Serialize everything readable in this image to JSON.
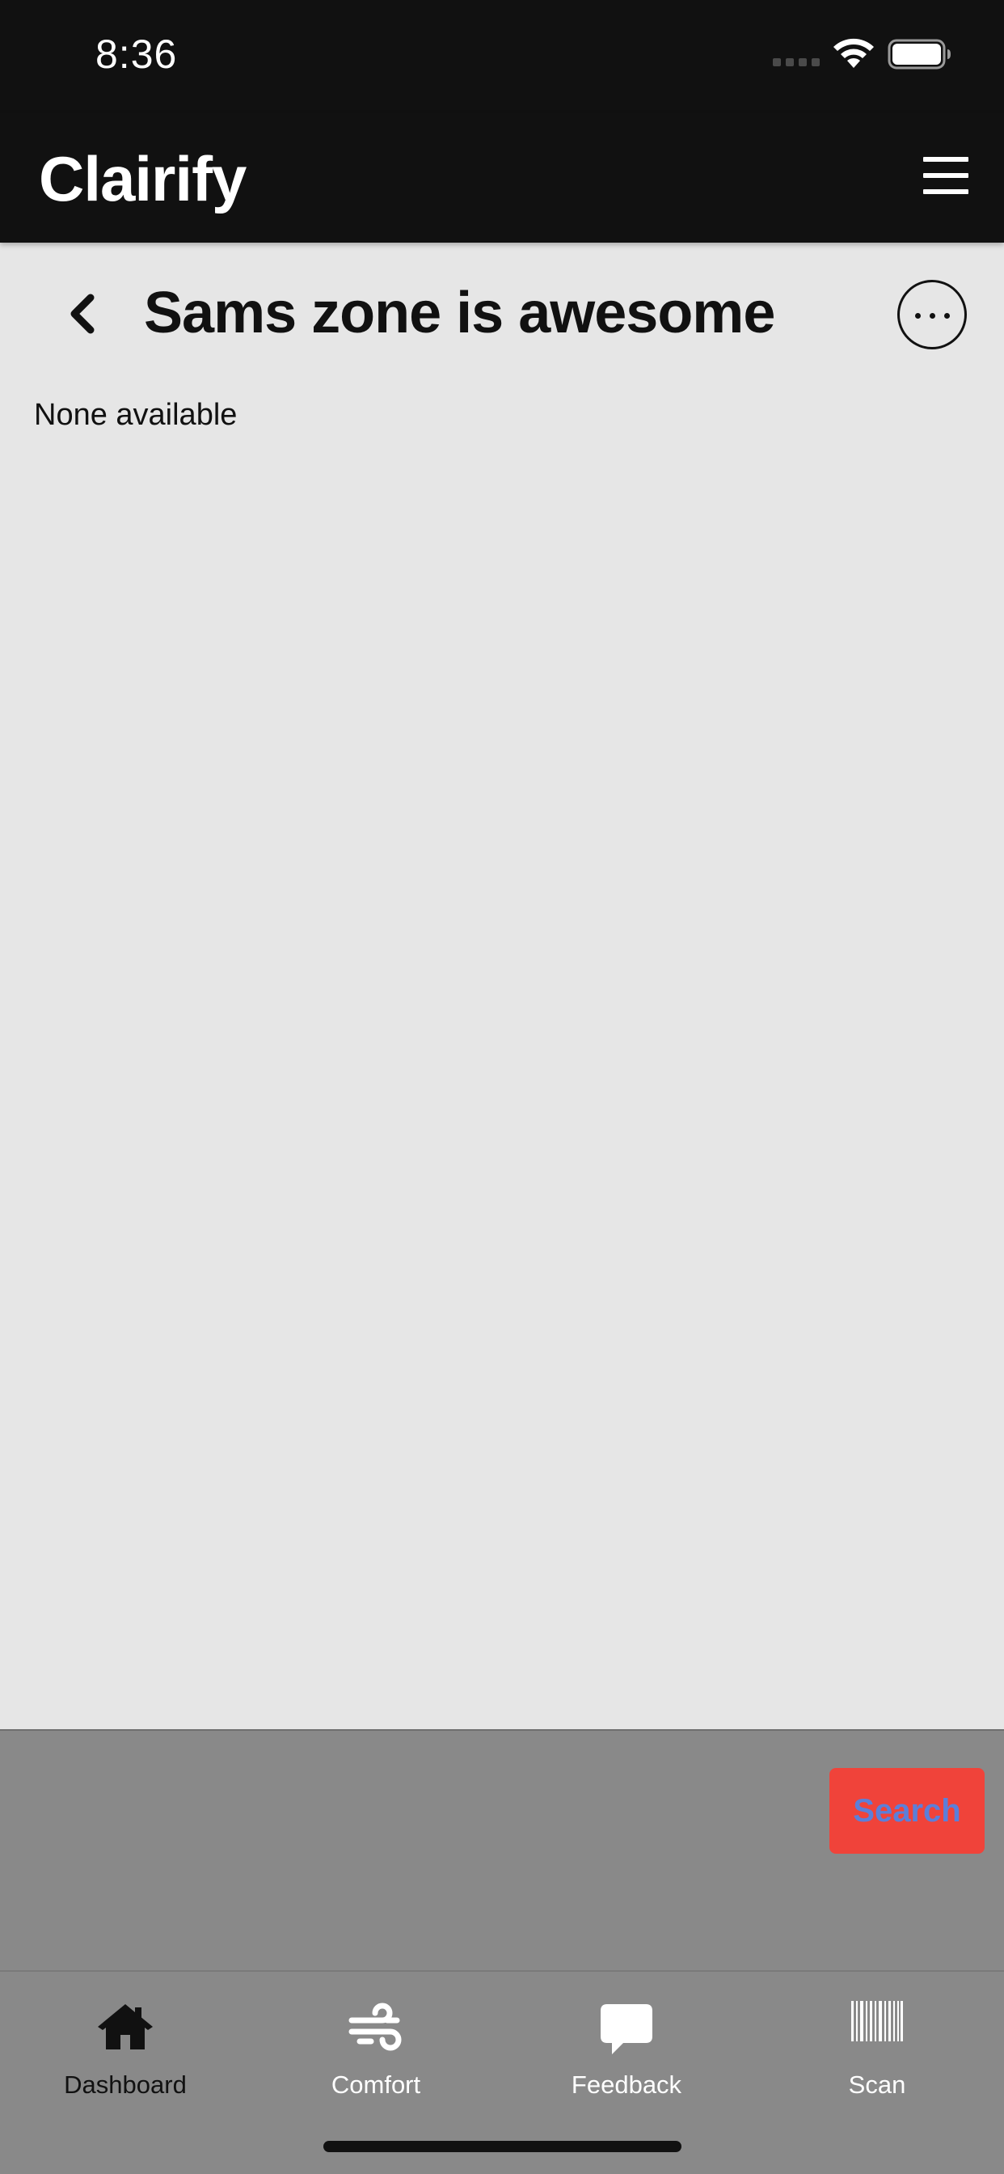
{
  "status_bar": {
    "time": "8:36"
  },
  "header": {
    "app_title": "Clairify"
  },
  "page": {
    "title": "Sams zone is awesome",
    "empty_message": "None available"
  },
  "search_panel": {
    "search_label": "Search"
  },
  "tabs": [
    {
      "label": "Dashboard",
      "icon": "home-icon",
      "active": true
    },
    {
      "label": "Comfort",
      "icon": "wind-icon",
      "active": false
    },
    {
      "label": "Feedback",
      "icon": "chat-bubble-icon",
      "active": false
    },
    {
      "label": "Scan",
      "icon": "barcode-icon",
      "active": false
    }
  ],
  "colors": {
    "header_bg": "#111111",
    "page_bg": "#e6e6e6",
    "bottom_panel_bg": "#898989",
    "search_button_bg": "#f0433a",
    "search_button_text": "#5c7fd9",
    "active_tab": "#111111",
    "inactive_tab": "#ffffff"
  }
}
